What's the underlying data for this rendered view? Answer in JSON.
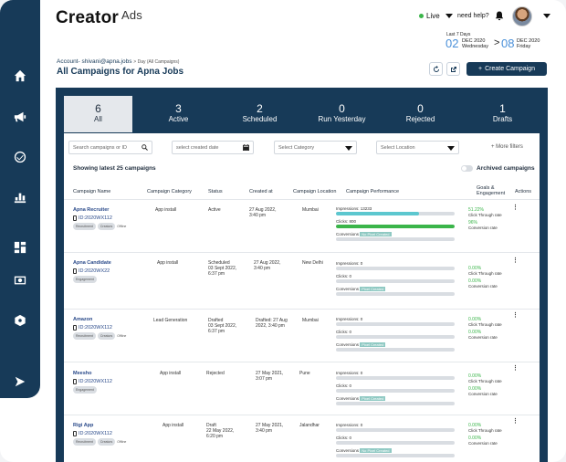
{
  "header": {
    "logo_main": "Creator",
    "logo_sub": "Ads",
    "live_label": "Live",
    "help_label": "need help?",
    "date_range": {
      "label": "Last 7 Days",
      "from_day": "02",
      "from_month": "DEC 2020",
      "from_weekday": "Wednesday",
      "sep": ">",
      "to_day": "08",
      "to_month": "DEC 2020",
      "to_weekday": "Friday"
    }
  },
  "sidebar": {
    "icons": [
      "home-icon",
      "megaphone-icon",
      "check-circle-icon",
      "bar-chart-icon",
      "dashboard-icon",
      "billing-icon",
      "shield-icon",
      "collapse-arrow-icon"
    ]
  },
  "page": {
    "account_label": "Account- shivani@apna.jobs",
    "account_sub": "> Day (All Campaigns)",
    "title": "All Campaigns for Apna Jobs",
    "create_button": "Create Campaign",
    "create_plus": "+"
  },
  "tabs": [
    {
      "count": "6",
      "label": "All",
      "active": true
    },
    {
      "count": "3",
      "label": "Active"
    },
    {
      "count": "2",
      "label": "Scheduled"
    },
    {
      "count": "0",
      "label": "Run Yesterday"
    },
    {
      "count": "0",
      "label": "Rejected"
    },
    {
      "count": "1",
      "label": "Drafts"
    }
  ],
  "filters": {
    "search_placeholder": "Search campaigns or ID",
    "date_placeholder": "select created date",
    "category_placeholder": "Select Category",
    "location_placeholder": "Select Location",
    "more_filters": "+ More filters"
  },
  "table": {
    "showing": "Showing latest 25 campaigns",
    "archived_label": "Archived campaigns",
    "columns": [
      "Campaign Name",
      "Campaign Category",
      "Status",
      "Created at",
      "Campaign Location",
      "Campaign Performance",
      "Goals & Engagement",
      "Actions"
    ],
    "rows": [
      {
        "name": "Apna Recruiter",
        "id": "ID:2020WX112",
        "tags": [
          "Recruitment",
          "Creators",
          "Offline"
        ],
        "category": "App install",
        "status": "Active",
        "status2": "",
        "status3": "",
        "created": "27 Aug 2022,",
        "created2": "3:40 pm",
        "location": "Mumbai",
        "impressions": "Impressions: 13233",
        "clicks": "Clicks: 800",
        "conversions": "Conversions",
        "conv_tag": "No Pixel Created",
        "imp_fill": 0.7,
        "clk_fill": 1.0,
        "goal1": "51.22%",
        "goal1_label": "Click Through rate",
        "goal2": "96%",
        "goal2_label": "Conversion rate"
      },
      {
        "name": "Apna Candidate",
        "id": "ID:2020WX22",
        "tags": [
          "Engagement"
        ],
        "category": "App install",
        "status": "Scheduled",
        "status2": "03 Sept 2022,",
        "status3": "6:37 pm",
        "created": "27 Aug 2022,",
        "created2": "3:40 pm",
        "location": "New Delhi",
        "impressions": "Impressions: 0",
        "clicks": "Clicks: 0",
        "conversions": "Conversions",
        "conv_tag": "Pixel Created",
        "imp_fill": 0,
        "clk_fill": 0,
        "goal1": "0.00%",
        "goal1_label": "Click Through rate",
        "goal2": "0.00%",
        "goal2_label": "Conversion rate"
      },
      {
        "name": "Amazon",
        "id": "ID:2020WX112",
        "tags": [
          "Recruitment",
          "Creators",
          "Offline"
        ],
        "category": "Lead Generation",
        "status": "Drafted",
        "status2": "03 Sept 2022,",
        "status3": "6:37 pm",
        "created": "Drafted: 27 Aug",
        "created2": "2022, 3:40 pm",
        "location": "Mumbai",
        "impressions": "Impressions: 0",
        "clicks": "Clicks: 0",
        "conversions": "Conversions",
        "conv_tag": "Pixel Created",
        "imp_fill": 0,
        "clk_fill": 0,
        "goal1": "0.00%",
        "goal1_label": "Click Through rate",
        "goal2": "0.00%",
        "goal2_label": "Conversion rate"
      },
      {
        "name": "Meesho",
        "id": "ID:2020WX112",
        "tags": [
          "Engagement"
        ],
        "category": "App install",
        "status": "Rejected",
        "status2": "",
        "status3": "",
        "created": "27 May 2021,",
        "created2": "3:07 pm",
        "location": "Pune",
        "impressions": "Impressions: 0",
        "clicks": "Clicks: 0",
        "conversions": "Conversions",
        "conv_tag": "Pixel Created",
        "imp_fill": 0,
        "clk_fill": 0,
        "goal1": "0.00%",
        "goal1_label": "Click Through rate",
        "goal2": "0.00%",
        "goal2_label": "Conversion rate"
      },
      {
        "name": "Rigi App",
        "id": "ID:2020WX112",
        "tags": [
          "Recruitment",
          "Creators",
          "Offline"
        ],
        "category": "App install",
        "status": "Draft",
        "status2": "22 May 2022,",
        "status3": "6:20 pm",
        "created": "27 May 2021,",
        "created2": "3:40 pm",
        "location": "Jalandhar",
        "impressions": "Impressions: 0",
        "clicks": "Clicks: 0",
        "conversions": "Conversions",
        "conv_tag": "No Pixel Created",
        "imp_fill": 0,
        "clk_fill": 0,
        "goal1": "0.00%",
        "goal1_label": "Click Through rate",
        "goal2": "0.00%",
        "goal2_label": "Conversion rate"
      }
    ]
  },
  "colors": {
    "navy": "#173a58",
    "accent_blue": "#4a90d9",
    "bar_teal": "#5cc7cf",
    "bar_green": "#3bb54a",
    "goal_green": "#3bb54a"
  }
}
